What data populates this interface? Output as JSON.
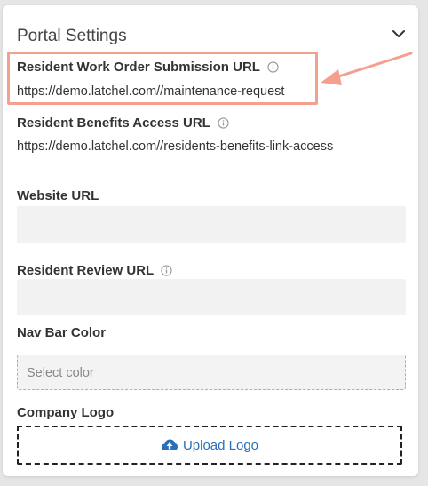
{
  "panel": {
    "title": "Portal Settings",
    "collapse_icon": "chevron-down-icon"
  },
  "fields": {
    "work_order_url": {
      "label": "Resident Work Order Submission URL",
      "value": "https://demo.latchel.com//maintenance-request"
    },
    "benefits_url": {
      "label": "Resident Benefits Access URL",
      "value": "https://demo.latchel.com//residents-benefits-link-access"
    },
    "website_url": {
      "label": "Website URL",
      "value": ""
    },
    "review_url": {
      "label": "Resident Review URL",
      "value": ""
    },
    "nav_bar_color": {
      "label": "Nav Bar Color",
      "placeholder": "Select color"
    },
    "company_logo": {
      "label": "Company Logo",
      "upload_label": "Upload Logo"
    }
  },
  "colors": {
    "highlight": "#f4a08e",
    "link": "#2a6fbb",
    "select_border": "#e6a24d"
  }
}
